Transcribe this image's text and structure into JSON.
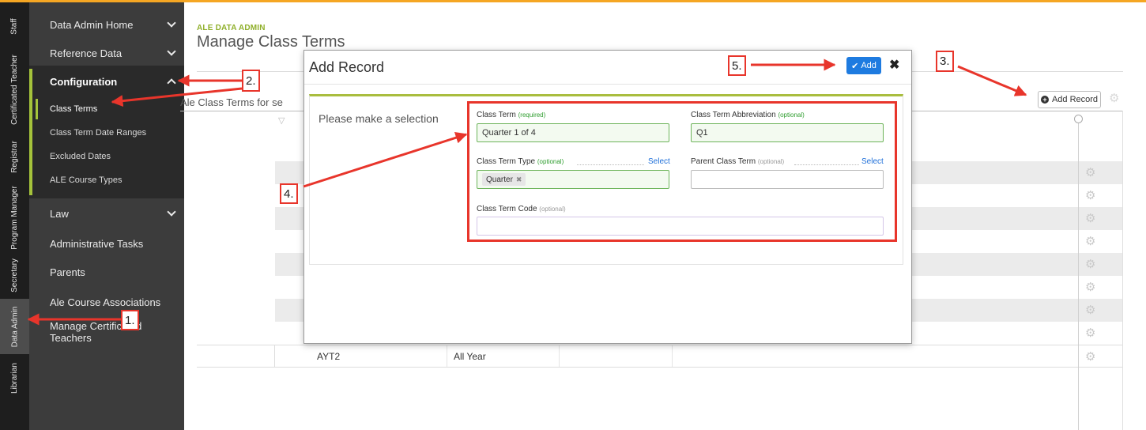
{
  "colors": {
    "top_accent": "#f5a623",
    "sidebar_bg": "#3c3c3c",
    "rail_bg": "#1e1e1e",
    "brand_green": "#a5c33b",
    "primary_button": "#1e7be0",
    "annotation_red": "#e8352b"
  },
  "rail": {
    "tabs": [
      {
        "label": "Staff"
      },
      {
        "label": "Certificated Teacher"
      },
      {
        "label": "Registrar"
      },
      {
        "label": "Program Manager"
      },
      {
        "label": "Secretary"
      },
      {
        "label": "Data Admin",
        "active": true
      },
      {
        "label": "Librarian"
      }
    ]
  },
  "sidebar": {
    "items": [
      {
        "label": "Data Admin Home",
        "icon": "chevron-down-icon"
      },
      {
        "label": "Reference Data",
        "icon": "chevron-down-icon"
      },
      {
        "label": "Configuration",
        "icon": "chevron-up-icon",
        "expanded": true
      },
      {
        "label": "Law",
        "icon": "chevron-down-icon"
      },
      {
        "label": "Administrative Tasks"
      },
      {
        "label": "Parents"
      },
      {
        "label": "Ale Course Associations"
      },
      {
        "label": "Manage Certificated Teachers"
      }
    ],
    "config_children": [
      {
        "label": "Class Terms",
        "active": true
      },
      {
        "label": "Class Term Date Ranges"
      },
      {
        "label": "Excluded Dates"
      },
      {
        "label": "ALE Course Types"
      }
    ]
  },
  "page": {
    "kicker": "ALE DATA ADMIN",
    "title": "Manage Class Terms",
    "section_title": "Ale Class Terms for se",
    "add_record_label": "Add Record"
  },
  "grid": {
    "rows": [
      {
        "code": "",
        "name": ""
      },
      {
        "code": "",
        "name": ""
      },
      {
        "code": "",
        "name": ""
      },
      {
        "code": "",
        "name": ""
      },
      {
        "code": "",
        "name": ""
      },
      {
        "code": "",
        "name": ""
      },
      {
        "code": "",
        "name": ""
      },
      {
        "code": "",
        "name": ""
      },
      {
        "code": "AYT2",
        "name": "All Year"
      }
    ]
  },
  "modal": {
    "title": "Add Record",
    "add_label": "Add",
    "close_icon": "close-icon",
    "prompt": "Please make a selection",
    "fields": {
      "class_term": {
        "label": "Class Term",
        "hint": "(required)",
        "value": "Quarter 1 of 4"
      },
      "abbreviation": {
        "label": "Class Term Abbreviation",
        "hint": "(optional)",
        "value": "Q1"
      },
      "type": {
        "label": "Class Term Type",
        "hint": "(optional)",
        "select_label": "Select",
        "chip": "Quarter"
      },
      "parent": {
        "label": "Parent Class Term",
        "hint": "(optional)",
        "select_label": "Select",
        "value": ""
      },
      "code": {
        "label": "Class Term Code",
        "hint": "(optional)",
        "value": ""
      }
    }
  },
  "annotations": {
    "step1": "1.",
    "step2": "2.",
    "step3": "3.",
    "step4": "4.",
    "step5": "5."
  }
}
